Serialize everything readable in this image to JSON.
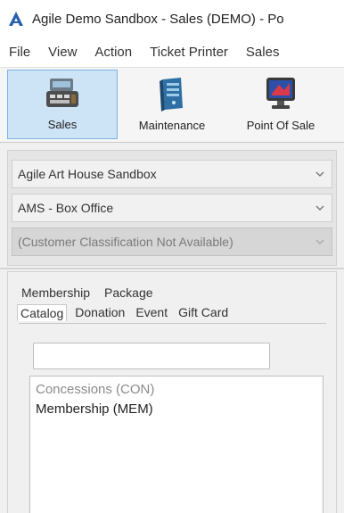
{
  "window": {
    "title": "Agile Demo Sandbox - Sales (DEMO) - Po"
  },
  "menu": {
    "items": [
      "File",
      "View",
      "Action",
      "Ticket Printer",
      "Sales"
    ]
  },
  "toolbar": {
    "buttons": [
      {
        "label": "Sales",
        "icon": "cash-register-icon",
        "active": true
      },
      {
        "label": "Maintenance",
        "icon": "server-icon",
        "active": false
      },
      {
        "label": "Point Of Sale",
        "icon": "monitor-icon",
        "active": false
      }
    ]
  },
  "selectors": {
    "organization": "Agile Art House Sandbox",
    "sales_channel": "AMS - Box Office",
    "customer_classification": "(Customer Classification Not Available)"
  },
  "tabs": {
    "row1": [
      "Membership",
      "Package"
    ],
    "row2": [
      "Catalog",
      "Donation",
      "Event",
      "Gift Card"
    ],
    "selected": "Catalog"
  },
  "search": {
    "value": ""
  },
  "catalog_list": {
    "items": [
      "Concessions  (CON)",
      "Membership  (MEM)"
    ]
  }
}
